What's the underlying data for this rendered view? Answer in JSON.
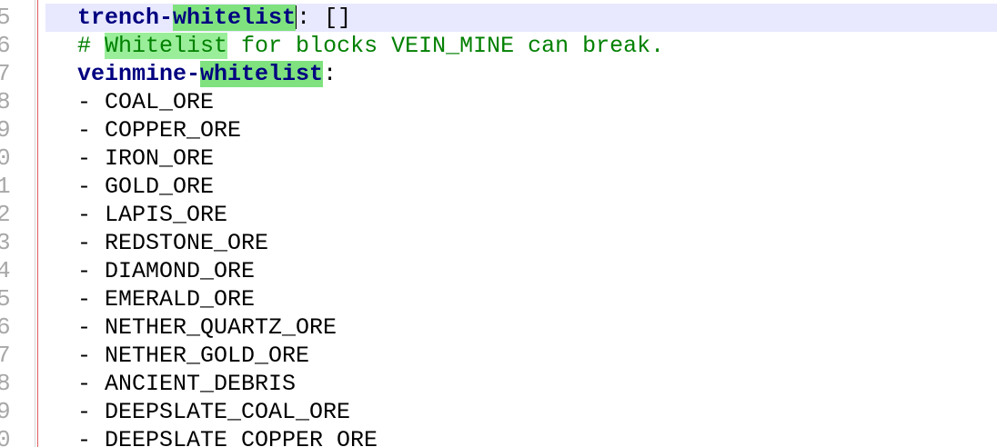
{
  "editor": {
    "line_numbers": [
      "5",
      "6",
      "7",
      "8",
      "9",
      "0",
      "1",
      "2",
      "3",
      "4",
      "5",
      "6",
      "7",
      "8",
      "9",
      "0"
    ],
    "line1": {
      "key_prefix": "trench-",
      "key_match": "whitelist",
      "rest": ": []"
    },
    "line2": {
      "hash": "# ",
      "match": "Whitelist",
      "rest": " for blocks VEIN_MINE can break."
    },
    "line3": {
      "key_prefix": "veinmine-",
      "key_match": "whitelist",
      "rest": ":"
    },
    "items": [
      "- COAL_ORE",
      "- COPPER_ORE",
      "- IRON_ORE",
      "- GOLD_ORE",
      "- LAPIS_ORE",
      "- REDSTONE_ORE",
      "- DIAMOND_ORE",
      "- EMERALD_ORE",
      "- NETHER_QUARTZ_ORE",
      "- NETHER_GOLD_ORE",
      "- ANCIENT_DEBRIS",
      "- DEEPSLATE_COAL_ORE",
      "- DEEPSLATE_COPPER_ORE"
    ]
  }
}
